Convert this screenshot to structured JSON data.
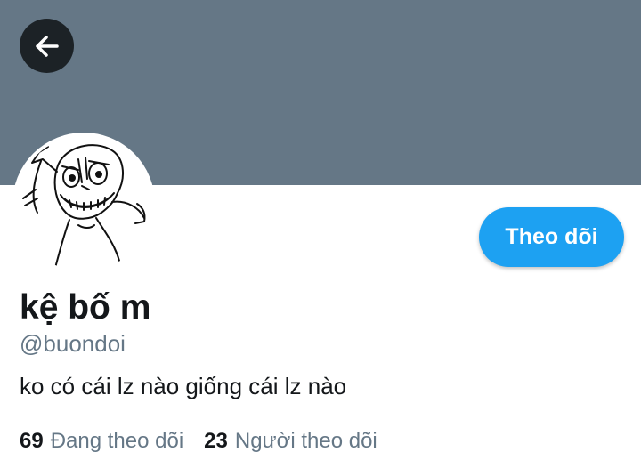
{
  "profile": {
    "display_name": "kệ bố m",
    "handle": "@buondoi",
    "bio": "ko có cái lz nào giống cái lz nào",
    "follow_button_label": "Theo dõi"
  },
  "stats": {
    "following_count": "69",
    "following_label": "Đang theo dõi",
    "followers_count": "23",
    "followers_label": "Người theo dõi"
  },
  "icons": {
    "back": "arrow-left-icon",
    "avatar": "troll-face-avatar"
  },
  "colors": {
    "banner": "#657786",
    "accent": "#1da1f2",
    "back_button": "#1c2226",
    "text_primary": "#14171a",
    "text_secondary": "#657786"
  }
}
